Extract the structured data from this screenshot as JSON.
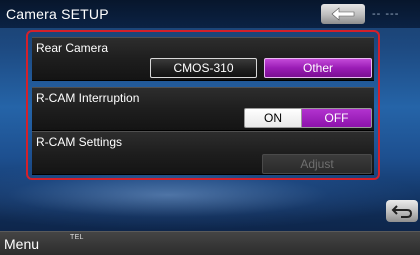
{
  "header": {
    "title": "Camera SETUP",
    "back_icon": "back-arrow-icon",
    "status_text": "-- ---"
  },
  "rows": {
    "rear_camera": {
      "label": "Rear Camera",
      "option_cmos": "CMOS-310",
      "option_other": "Other",
      "selected": "Other"
    },
    "interruption": {
      "label": "R-CAM Interruption",
      "on_label": "ON",
      "off_label": "OFF",
      "selected": "OFF"
    },
    "settings": {
      "label": "R-CAM Settings",
      "adjust_label": "Adjust",
      "adjust_enabled": false
    }
  },
  "footer": {
    "menu_label": "Menu",
    "tel_label": "TEL",
    "return_icon": "return-arrow-icon"
  },
  "colors": {
    "highlight_frame": "#d4202a",
    "selected_purple": "#9a1cb5",
    "background_blue": "#2564a8"
  }
}
